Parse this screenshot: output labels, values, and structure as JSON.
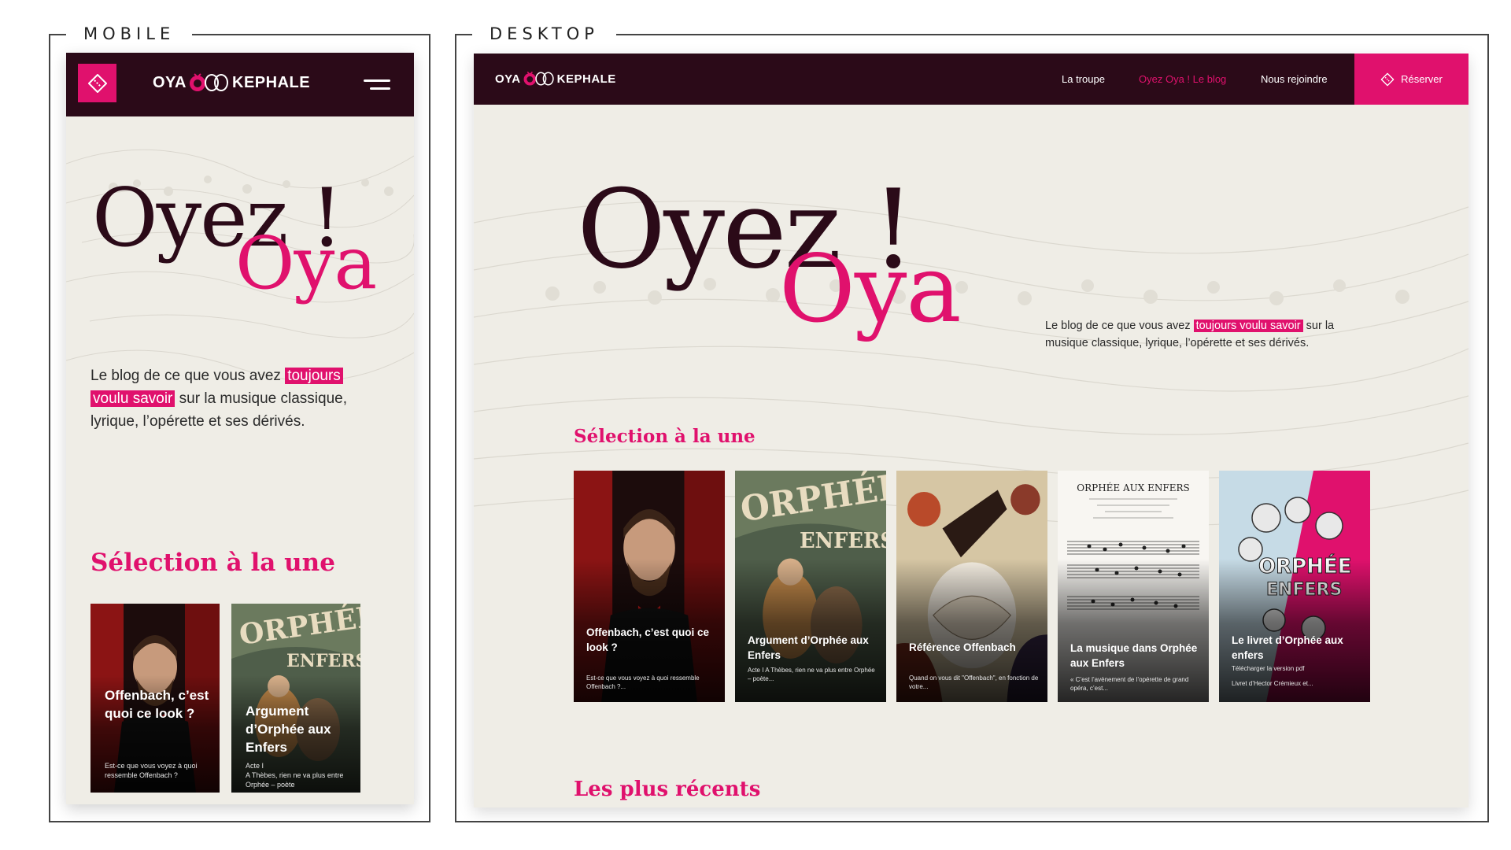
{
  "frames": {
    "mobile_label": "MOBILE",
    "desktop_label": "DESKTOP"
  },
  "brand": {
    "logo_left": "OYA",
    "logo_right": "KEPHALE",
    "accent": "#e0116d",
    "dark": "#2b0a18"
  },
  "nav": {
    "items": [
      {
        "label": "La troupe",
        "active": false
      },
      {
        "label": "Oyez Oya ! Le blog",
        "active": true
      },
      {
        "label": "Nous rejoindre",
        "active": false
      }
    ],
    "reserve_label": "Réserver"
  },
  "hero": {
    "title_line1": "Oyez !",
    "title_line2": "Oya",
    "intro_before": "Le blog de ce que vous avez ",
    "intro_highlight_mobile_1": "toujours",
    "intro_highlight_mobile_2": "voulu savoir",
    "intro_highlight": "toujours voulu savoir",
    "intro_after": " sur la musique classique, lyrique, l’opérette et ses dérivés."
  },
  "sections": {
    "featured": "Sélection à la une",
    "recent": "Les plus récents"
  },
  "cards": [
    {
      "title": "Offenbach, c’est quoi ce look ?",
      "excerpt": "Est-ce que vous voyez à quoi ressemble Offenbach ?..."
    },
    {
      "title": "Argument d’Orphée aux Enfers",
      "excerpt": "Acte I A Thèbes, rien ne va plus entre Orphée – poète..."
    },
    {
      "title": "Référence Offenbach",
      "excerpt": "Quand on vous dit \"Offenbach\", en fonction de votre..."
    },
    {
      "title": "La musique dans Orphée aux Enfers",
      "excerpt": "« C’est l’avènement de l’opérette de grand opéra, c’est..."
    },
    {
      "title": "Le livret d’Orphée aux enfers",
      "excerpt_line1": "Télécharger la version pdf",
      "excerpt_line2": "Livret d’Hector Crémieux et..."
    }
  ],
  "mobile_cards": [
    {
      "title": "Offenbach, c’est quoi ce look ?",
      "excerpt": "Est-ce que vous voyez à quoi ressemble Offenbach ?"
    },
    {
      "title": "Argument d’Orphée aux Enfers",
      "excerpt_line1": "Acte I",
      "excerpt_line2": "A Thèbes, rien ne va plus entre Orphée – poète"
    }
  ],
  "icons": {
    "ticket": "ticket-icon",
    "menu": "hamburger-menu-icon"
  }
}
